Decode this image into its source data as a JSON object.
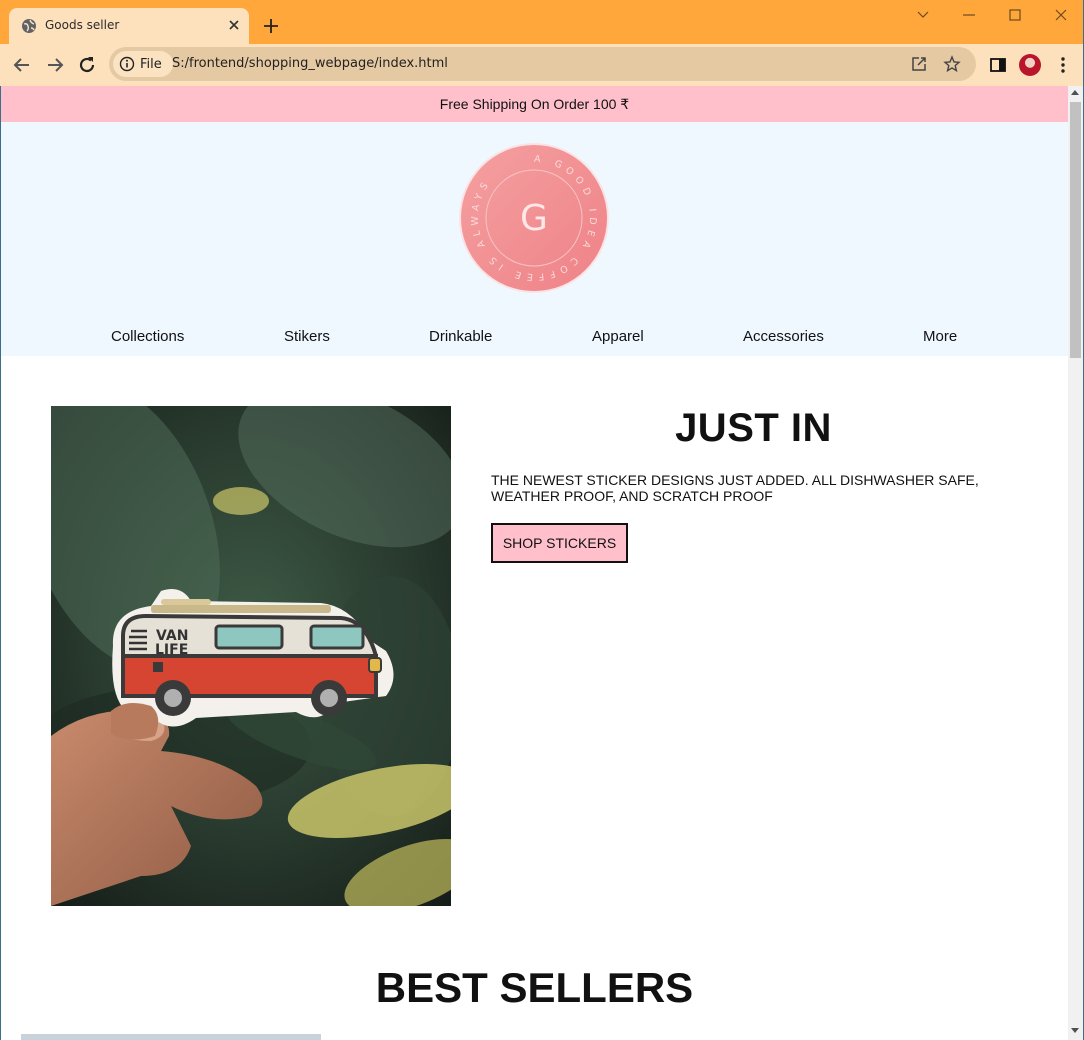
{
  "browser": {
    "tab_title": "Goods seller",
    "site_chip_label": "File",
    "url": "S:/frontend/shopping_webpage/index.html",
    "icons": [
      "globe-icon",
      "close-icon",
      "plus-icon",
      "chevron-down-icon",
      "minimize-icon",
      "maximize-icon",
      "window-close-icon",
      "back-arrow-icon",
      "forward-arrow-icon",
      "reload-icon",
      "info-icon",
      "share-icon",
      "star-icon",
      "side-panel-icon",
      "avatar",
      "kebab-menu-icon"
    ]
  },
  "colors": {
    "titlebar": "#ffa73b",
    "toolbar": "#fde1bd",
    "announce_bg": "#ffc0cb",
    "header_bg": "#f0f8ff",
    "button_bg": "#ffc0cb",
    "logo_pink": "#f08c8f"
  },
  "announcement": "Free Shipping On Order 100 ₹",
  "logo": {
    "letter": "G",
    "ring_text": "A GOOD IDEA  COFFEE IS ALWAYS"
  },
  "nav": {
    "items": [
      "Collections",
      "Stikers",
      "Drinkable",
      "Apparel",
      "Accessories",
      "More"
    ]
  },
  "hero": {
    "image_sticker_text": "VAN LIFE",
    "title": "JUST IN",
    "description": "THE NEWEST STICKER DESIGNS JUST ADDED. ALL DISHWASHER SAFE, WEATHER PROOF, AND SCRATCH PROOF",
    "button_label": "SHOP STICKERS"
  },
  "best_sellers": {
    "title": "BEST SELLERS"
  }
}
